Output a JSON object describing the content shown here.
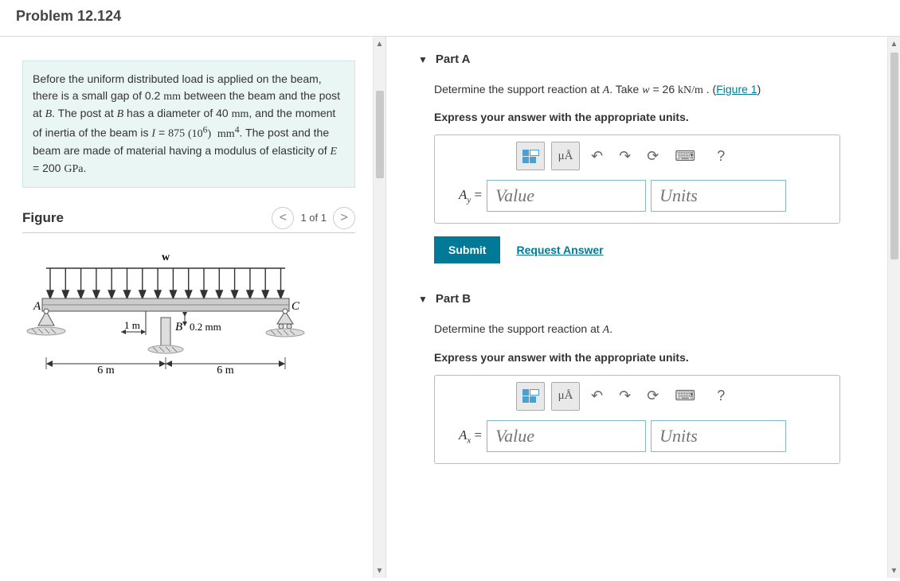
{
  "header": {
    "title": "Problem 12.124"
  },
  "left": {
    "info_html": "Before the uniform distributed load is applied on the beam, there is a small gap of 0.2 mm between the beam and the post at B. The post at B has a diameter of 40 mm, and the moment of inertia of the beam is I = 875 (10^6) mm^4. The post and the beam are made of material having a modulus of elasticity of E = 200 GPa.",
    "info_gap": "0.2",
    "info_gap_unit": "mm",
    "info_diameter": "40",
    "info_diameter_unit": "mm",
    "info_I": "875",
    "info_I_exp": "6",
    "info_I_unit": "mm",
    "info_E": "200",
    "info_E_unit": "GPa",
    "figure_label": "Figure",
    "pager": {
      "prev": "<",
      "text": "1 of 1",
      "next": ">"
    },
    "diagram": {
      "load_label": "w",
      "pointA": "A",
      "pointB": "B",
      "pointC": "C",
      "dim_1m": "1 m",
      "gap": "0.2 mm",
      "span_left": "6 m",
      "span_right": "6 m"
    }
  },
  "right": {
    "partA": {
      "title": "Part A",
      "instruction_pre": "Determine the support reaction at ",
      "instruction_var": "A",
      "instruction_mid": ". Take ",
      "instruction_wvar": "w",
      "instruction_eq": " = 26 ",
      "instruction_unit": "kN/m",
      "instruction_post": " . (",
      "figure_link": "Figure 1",
      "instruction_close": ")",
      "sub": "Express your answer with the appropriate units.",
      "mu_label": "μÅ",
      "lhs_sym": "A",
      "lhs_sub": "y",
      "eq": " = ",
      "value_ph": "Value",
      "units_ph": "Units",
      "submit": "Submit",
      "request": "Request Answer"
    },
    "partB": {
      "title": "Part B",
      "instruction_pre": "Determine the support reaction at ",
      "instruction_var": "A",
      "instruction_post": ".",
      "sub": "Express your answer with the appropriate units.",
      "mu_label": "μÅ",
      "lhs_sym": "A",
      "lhs_sub": "x",
      "eq": " = ",
      "value_ph": "Value",
      "units_ph": "Units"
    },
    "toolbar": {
      "undo": "↶",
      "redo": "↷",
      "reset": "⟳",
      "keyboard": "⌨",
      "help": "?"
    }
  }
}
